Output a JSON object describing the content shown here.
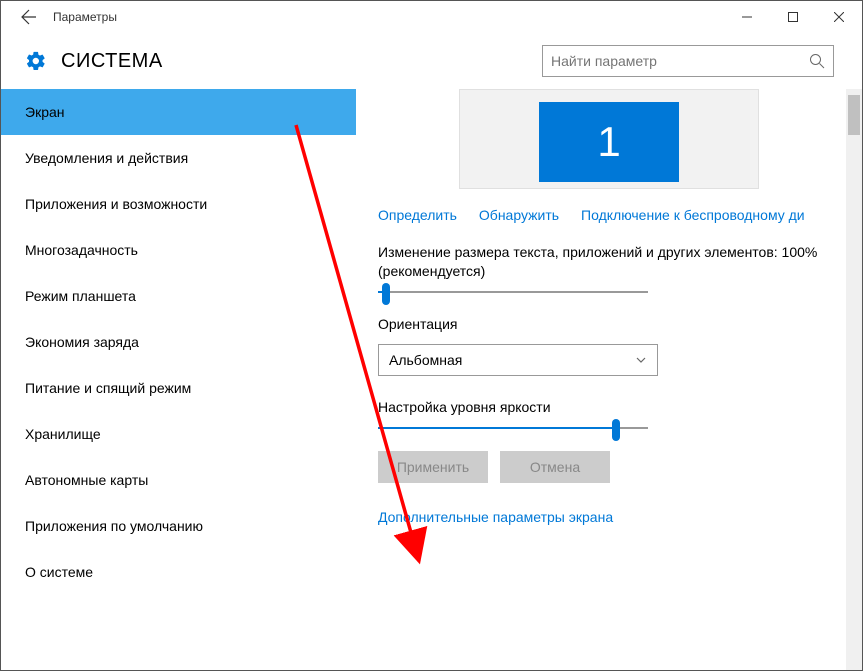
{
  "window": {
    "title": "Параметры"
  },
  "header": {
    "page_title": "СИСТЕМА"
  },
  "search": {
    "placeholder": "Найти параметр"
  },
  "sidebar": {
    "items": [
      {
        "label": "Экран",
        "active": true
      },
      {
        "label": "Уведомления и действия"
      },
      {
        "label": "Приложения и возможности"
      },
      {
        "label": "Многозадачность"
      },
      {
        "label": "Режим планшета"
      },
      {
        "label": "Экономия заряда"
      },
      {
        "label": "Питание и спящий режим"
      },
      {
        "label": "Хранилище"
      },
      {
        "label": "Автономные карты"
      },
      {
        "label": "Приложения по умолчанию"
      },
      {
        "label": "О системе"
      }
    ]
  },
  "content": {
    "monitor_number": "1",
    "links": {
      "identify": "Определить",
      "detect": "Обнаружить",
      "wireless": "Подключение к беспроводному ди"
    },
    "scale_label": "Изменение размера текста, приложений и других элементов: 100% (рекомендуется)",
    "orientation_label": "Ориентация",
    "orientation_value": "Альбомная",
    "brightness_label": "Настройка уровня яркости",
    "apply_btn": "Применить",
    "cancel_btn": "Отмена",
    "advanced_link": "Дополнительные параметры экрана",
    "scale_slider_pct": 3,
    "brightness_slider_pct": 88
  }
}
